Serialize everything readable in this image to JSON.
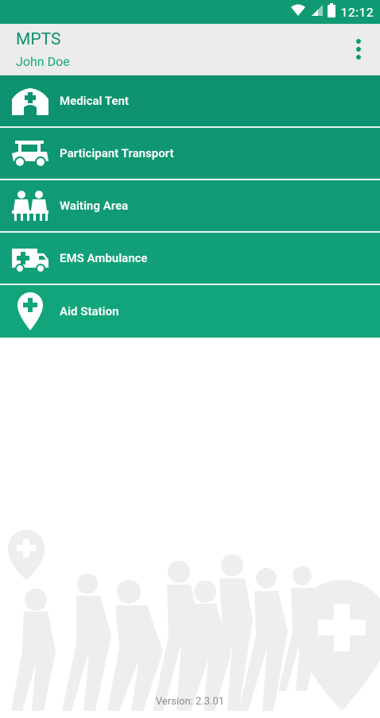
{
  "status_bar": {
    "time": "12:12",
    "icons": [
      "wifi-icon",
      "signal-icon",
      "battery-icon"
    ]
  },
  "app_bar": {
    "title": "MPTS",
    "subtitle": "John Doe",
    "menu_icon": "overflow-menu-icon"
  },
  "menu": {
    "items": [
      {
        "label": "Medical Tent",
        "icon": "medical-tent-icon",
        "color": "#0e9270"
      },
      {
        "label": "Participant Transport",
        "icon": "golf-cart-icon",
        "color": "#0f9773"
      },
      {
        "label": "Waiting Area",
        "icon": "waiting-area-icon",
        "color": "#109b76"
      },
      {
        "label": "EMS Ambulance",
        "icon": "ambulance-icon",
        "color": "#11a079"
      },
      {
        "label": "Aid Station",
        "icon": "aid-station-icon",
        "color": "#12a57c"
      }
    ]
  },
  "footer": {
    "version": "Version: 2.3.01"
  },
  "colors": {
    "primary": "#0f9a73",
    "app_bar_bg": "#ececec",
    "title": "#0f8f6b",
    "version_text": "#8c8c8c"
  }
}
